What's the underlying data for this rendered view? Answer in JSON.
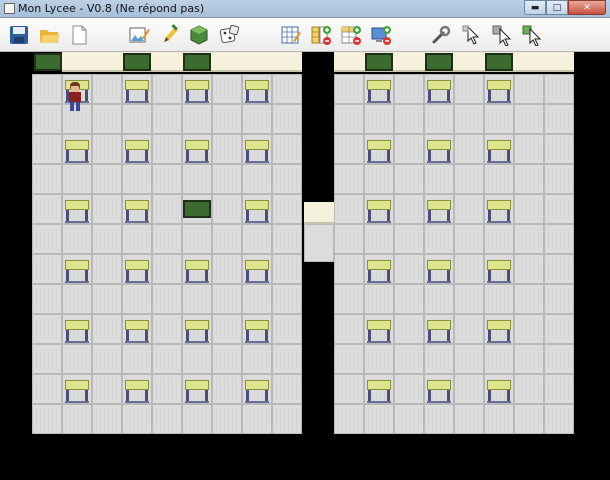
{
  "window": {
    "title": "Mon Lycee - V0.8 (Ne répond pas)",
    "buttons": [
      "minimize",
      "maximize",
      "close"
    ]
  },
  "toolbar": {
    "tools": [
      {
        "id": "save",
        "icon": "save-icon"
      },
      {
        "id": "open",
        "icon": "folder-open-icon"
      },
      {
        "id": "new",
        "icon": "new-document-icon"
      },
      {
        "id": "draw",
        "icon": "picture-pencil-icon"
      },
      {
        "id": "pencil",
        "icon": "pencil-icon"
      },
      {
        "id": "board",
        "icon": "green-board-icon"
      },
      {
        "id": "dice",
        "icon": "dice-icon"
      },
      {
        "id": "grid-edit",
        "icon": "grid-edit-icon"
      },
      {
        "id": "add-row",
        "icon": "add-row-icon"
      },
      {
        "id": "add-column",
        "icon": "add-column-icon"
      },
      {
        "id": "add-screen",
        "icon": "add-screen-icon"
      },
      {
        "id": "settings",
        "icon": "wrench-icon"
      },
      {
        "id": "select",
        "icon": "cursor-select-icon"
      },
      {
        "id": "select-multi",
        "icon": "cursor-multi-icon"
      },
      {
        "id": "select-green",
        "icon": "cursor-green-icon"
      }
    ]
  },
  "colors": {
    "floor": "#dcdcdc",
    "wall": "#f4f0dc",
    "board": "#3b6b2e",
    "desk": "#dfe58c",
    "background": "#000000"
  }
}
